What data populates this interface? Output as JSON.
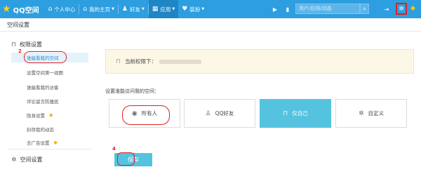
{
  "topbar": {
    "logo_text": "QQ空间",
    "nav": [
      {
        "label": "个人中心",
        "icon": "home-user-icon",
        "caret": false
      },
      {
        "label": "我的主页",
        "icon": "house-icon",
        "caret": true
      },
      {
        "label": "好友",
        "icon": "friends-icon",
        "caret": true
      },
      {
        "label": "应用",
        "icon": "apps-grid-icon",
        "caret": true
      },
      {
        "label": "装扮",
        "icon": "dress-up-icon",
        "caret": true
      }
    ],
    "search_placeholder": "用户/应用/动态",
    "colors": {
      "bar": "#2d9ee0",
      "active_tab": "#1f86c6",
      "annotation_red": "#e02020"
    }
  },
  "section_title": "空间设置",
  "sidebar": {
    "group1": "权限设置",
    "items": [
      {
        "label": "谁能看我的空间",
        "active": true,
        "gem": false
      },
      {
        "label": "设置空间第一视图",
        "active": false,
        "gem": false
      },
      {
        "label": "谁能看我的访客",
        "active": false,
        "gem": false
      },
      {
        "label": "评论留言防骚扰",
        "active": false,
        "gem": false
      },
      {
        "label": "隐身设置",
        "active": false,
        "gem": true
      },
      {
        "label": "封存我的动态",
        "active": false,
        "gem": false
      },
      {
        "label": "去广告设置",
        "active": false,
        "gem": true
      }
    ],
    "group2": "空间设置"
  },
  "annotations": {
    "n2": "2",
    "n3": "3",
    "n4": "4"
  },
  "main": {
    "current_permission_label": "当前权限下：",
    "question": "设置谁能访问我的空间：",
    "options": [
      {
        "label": "所有人",
        "icon": "globe-icon",
        "selected": false
      },
      {
        "label": "QQ好友",
        "icon": "qq-penguin-icon",
        "selected": false
      },
      {
        "label": "仅自己",
        "icon": "lock-icon",
        "selected": true
      },
      {
        "label": "自定义",
        "icon": "gear-icon",
        "selected": false
      }
    ],
    "save_label": "保存",
    "accent": "#55c3e0"
  }
}
